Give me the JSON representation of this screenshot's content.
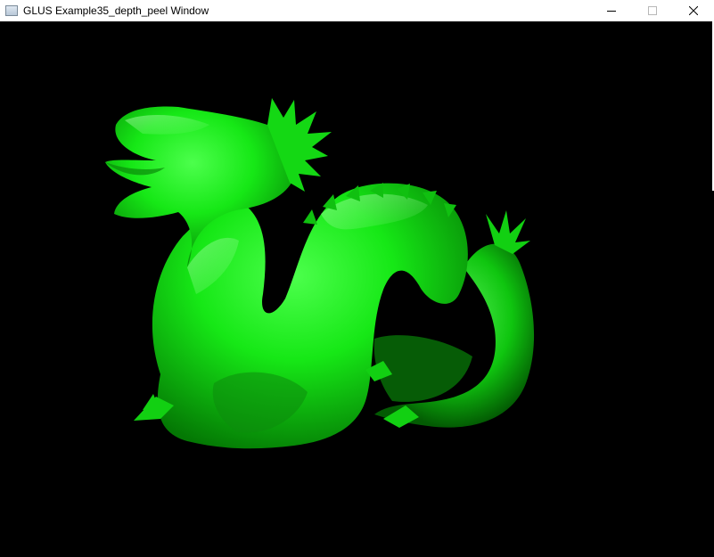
{
  "window": {
    "title": "GLUS Example35_depth_peel Window",
    "controls": {
      "minimize_icon": "minimize-icon",
      "maximize_icon": "maximize-icon",
      "close_icon": "close-icon"
    }
  },
  "viewport": {
    "background_color": "#000000",
    "model": "dragon",
    "model_color": "#00d800"
  }
}
